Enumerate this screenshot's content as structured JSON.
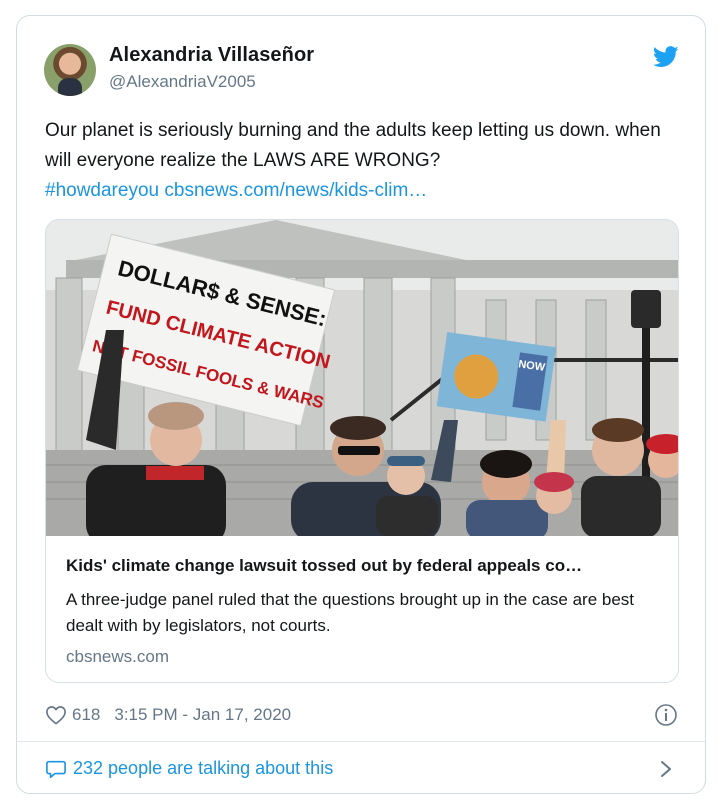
{
  "author": {
    "name": "Alexandria Villaseñor",
    "handle": "@AlexandriaV2005"
  },
  "tweet": {
    "text": "Our planet is seriously burning and the adults keep letting us down. when will everyone realize the LAWS ARE WRONG? ",
    "hashtag": "#howdareyou",
    "url": "cbsnews.com/news/kids-clim…"
  },
  "photo": {
    "sign_left_lines": [
      "DOLLAR$ & SENSE:",
      "FUND CLIMATE ACTION",
      "NOT FOSSIL FOOLS & WARS"
    ],
    "sign_right_text": "NOW"
  },
  "link_card": {
    "title": "Kids' climate change lawsuit tossed out by federal appeals co…",
    "description": "A three-judge panel ruled that the questions brought up in the case are best dealt with by legislators, not courts.",
    "domain": "cbsnews.com"
  },
  "meta": {
    "likes": "618",
    "timestamp": "3:15 PM - Jan 17, 2020"
  },
  "conversation": {
    "label": "232 people are talking about this"
  },
  "icons": [
    "twitter-bird-icon",
    "heart-icon",
    "info-icon",
    "speech-bubble-icon",
    "chevron-right-icon"
  ],
  "colors": {
    "link": "#1b95e0",
    "secondary": "#657786",
    "brand": "#1da1f2"
  }
}
